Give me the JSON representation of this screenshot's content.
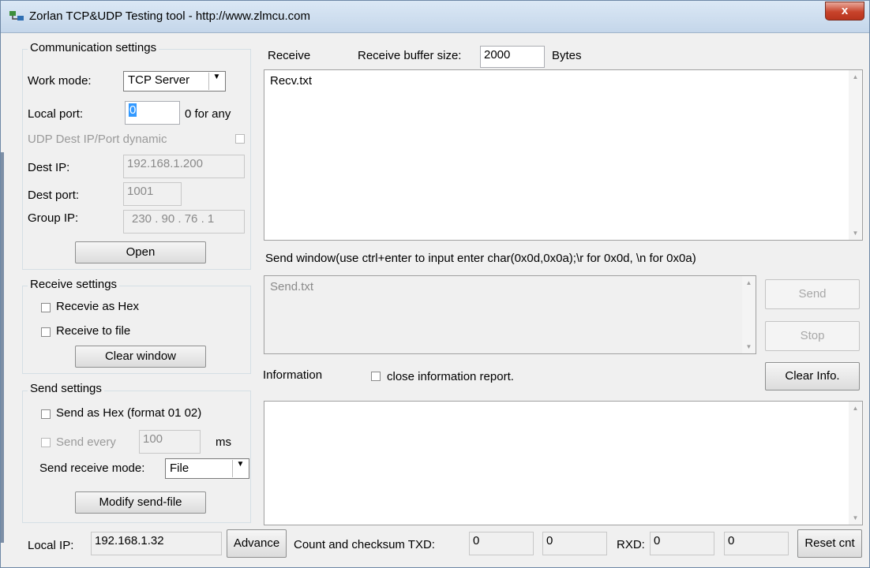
{
  "window": {
    "title": "Zorlan TCP&UDP Testing tool - http://www.zlmcu.com",
    "close_label": "x"
  },
  "communication": {
    "title": "Communication settings",
    "work_mode_label": "Work mode:",
    "work_mode_value": "TCP Server",
    "local_port_label": "Local port:",
    "local_port_value": "0",
    "local_port_hint": "0 for any",
    "udp_dynamic_label": "UDP Dest IP/Port dynamic",
    "dest_ip_label": "Dest IP:",
    "dest_ip_value": "192.168.1.200",
    "dest_port_label": "Dest port:",
    "dest_port_value": "1001",
    "group_ip_label": "Group IP:",
    "group_ip_value": "230 . 90 . 76 . 1",
    "open_label": "Open"
  },
  "receive_settings": {
    "title": "Receive settings",
    "hex_label": "Recevie as Hex",
    "file_label": "Receive to file",
    "clear_label": "Clear window"
  },
  "send_settings": {
    "title": "Send settings",
    "hex_label": "Send as Hex (format 01 02)",
    "every_label": "Send every",
    "every_value": "100",
    "every_unit": "ms",
    "mode_label": "Send receive mode:",
    "mode_value": "File",
    "modify_label": "Modify send-file"
  },
  "receive": {
    "label": "Receive",
    "buffer_label": "Receive buffer size:",
    "buffer_value": "2000",
    "buffer_unit": "Bytes",
    "content": "Recv.txt"
  },
  "send": {
    "hint": "Send window(use ctrl+enter to input enter char(0x0d,0x0a);\\r for 0x0d, \\n for 0x0a)",
    "content": "Send.txt",
    "send_label": "Send",
    "stop_label": "Stop"
  },
  "info": {
    "label": "Information",
    "close_report_label": "close information report.",
    "clear_label": "Clear Info."
  },
  "status": {
    "local_ip_label": "Local IP:",
    "local_ip_value": "192.168.1.32",
    "advance_label": "Advance",
    "count_label": "Count and checksum TXD:",
    "txd1": "0",
    "txd2": "0",
    "rxd_label": "RXD:",
    "rxd1": "0",
    "rxd2": "0",
    "reset_label": "Reset cnt"
  }
}
